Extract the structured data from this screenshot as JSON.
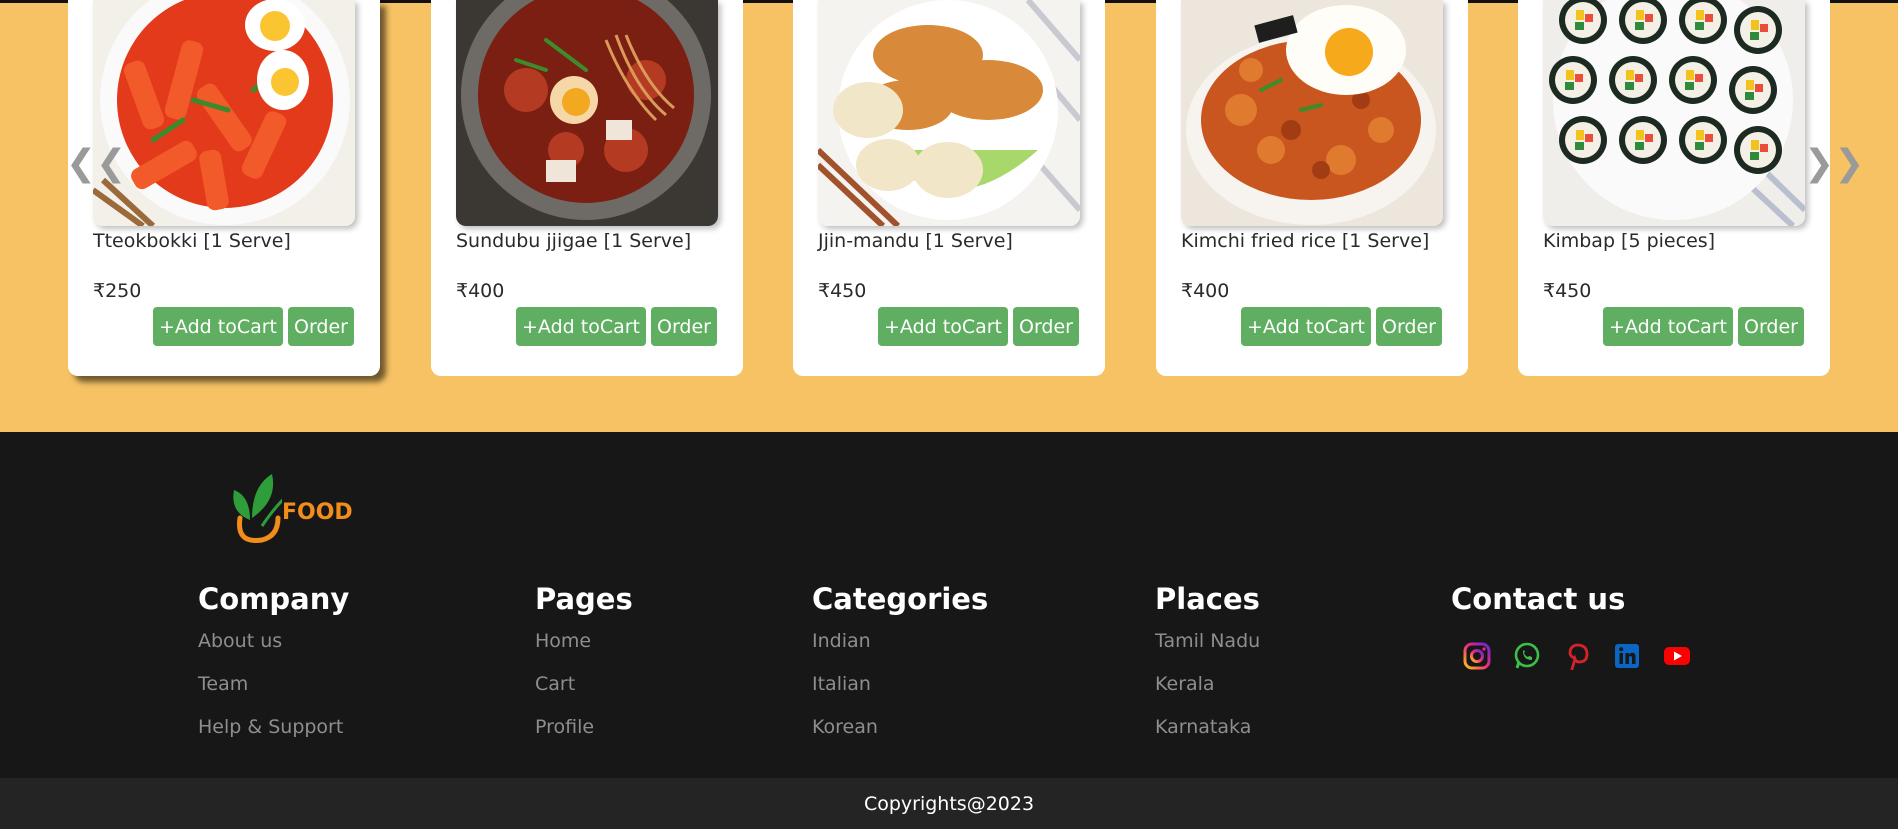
{
  "carousel": {
    "prev_icon": "chevron-double-left-icon",
    "next_icon": "chevron-double-right-icon",
    "prev_label": "❮❮",
    "next_label": "❯❯",
    "items": [
      {
        "name": "Tteokbokki [1 Serve]",
        "price": "₹250",
        "add_label": "+Add toCart",
        "order_label": "Order"
      },
      {
        "name": "Sundubu jjigae [1 Serve]",
        "price": "₹400",
        "add_label": "+Add toCart",
        "order_label": "Order"
      },
      {
        "name": "Jjin-mandu [1 Serve]",
        "price": "₹450",
        "add_label": "+Add toCart",
        "order_label": "Order"
      },
      {
        "name": "Kimchi fried rice [1 Serve]",
        "price": "₹400",
        "add_label": "+Add toCart",
        "order_label": "Order"
      },
      {
        "name": "Kimbap [5 pieces]",
        "price": "₹450",
        "add_label": "+Add toCart",
        "order_label": "Order"
      }
    ]
  },
  "footer": {
    "logo_text": "FOOD",
    "company": {
      "title": "Company",
      "links": [
        "About us",
        "Team",
        "Help & Support"
      ]
    },
    "pages": {
      "title": "Pages",
      "links": [
        "Home",
        "Cart",
        "Profile"
      ]
    },
    "categories": {
      "title": "Categories",
      "links": [
        "Indian",
        "Italian",
        "Korean"
      ]
    },
    "places": {
      "title": "Places",
      "links": [
        "Tamil Nadu",
        "Kerala",
        "Karnataka"
      ]
    },
    "contact": {
      "title": "Contact us",
      "icons": [
        "instagram-icon",
        "whatsapp-icon",
        "pinterest-icon",
        "linkedin-icon",
        "youtube-icon"
      ]
    },
    "copyright": "Copyrights@2023"
  },
  "colors": {
    "background": "#f6c264",
    "footer": "#171717",
    "button": "#5fae61",
    "logo_orange": "#f28c1a",
    "logo_green": "#2f9e3a"
  }
}
